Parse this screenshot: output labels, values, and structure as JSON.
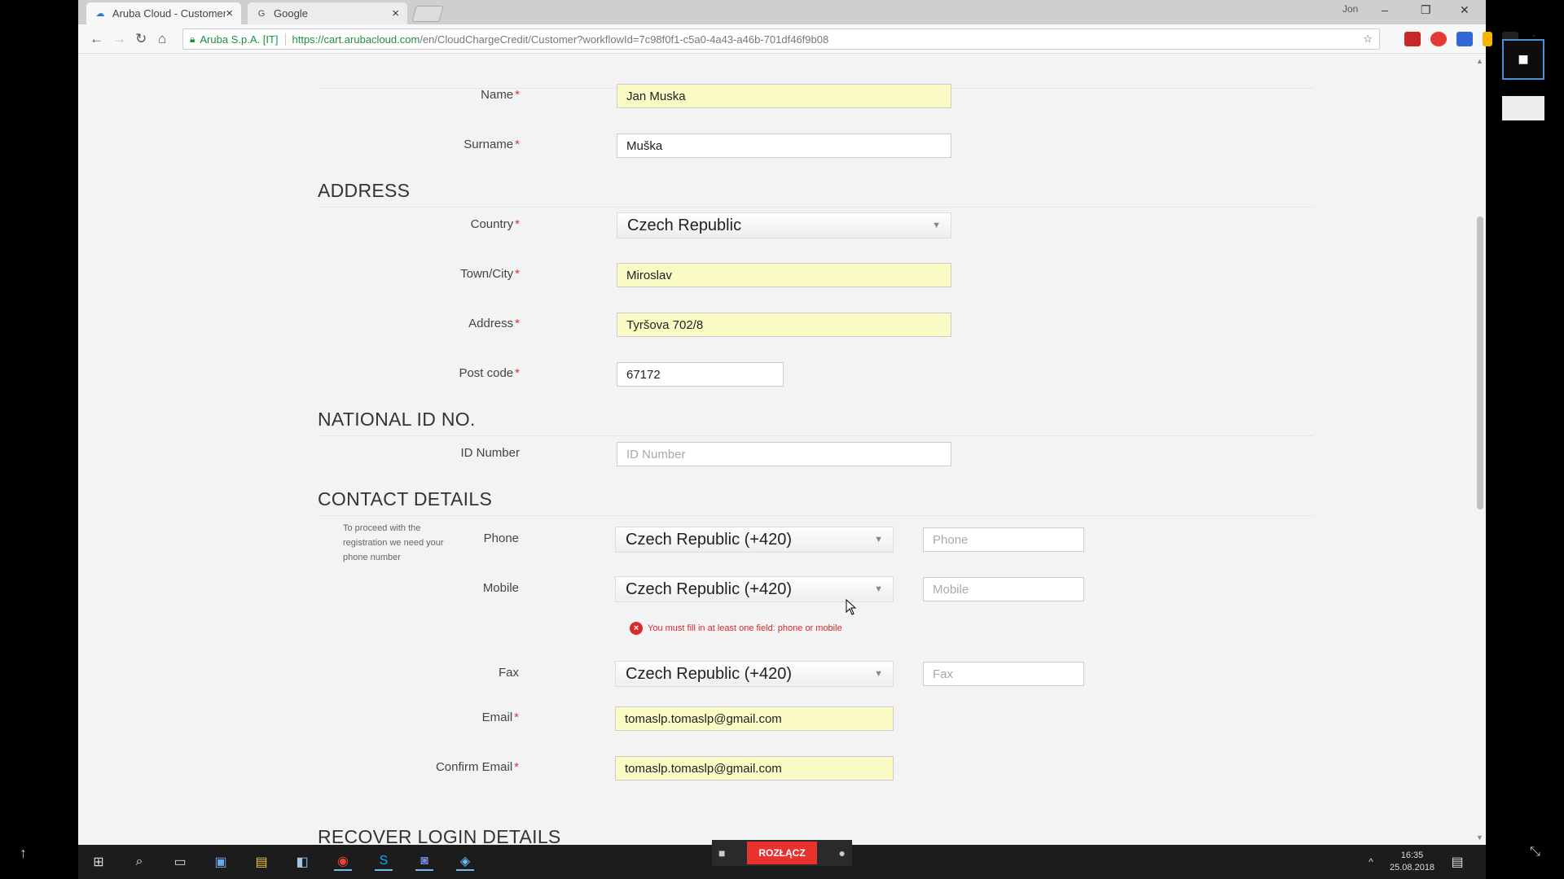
{
  "browser": {
    "tabs": [
      {
        "title": "Aruba Cloud - Customer",
        "active": true
      },
      {
        "title": "Google",
        "active": false
      }
    ],
    "window_controls": {
      "user": "Jon",
      "minimize": "–",
      "restore": "❐",
      "close": "✕"
    },
    "security_label": "Aruba S.p.A. [IT]",
    "url_host": "https://cart.arubacloud.com",
    "url_path": "/en/CloudChargeCredit/Customer?workflowId=7c98f0f1-c5a0-4a43-a46b-701df46f9b08"
  },
  "form": {
    "name": {
      "label": "Name",
      "required": "*",
      "value": "Jan Muska"
    },
    "surname": {
      "label": "Surname",
      "required": "*",
      "value": "Muška"
    },
    "address_section": "ADDRESS",
    "country": {
      "label": "Country",
      "required": "*",
      "value": "Czech Republic"
    },
    "town": {
      "label": "Town/City",
      "required": "*",
      "value": "Miroslav"
    },
    "address": {
      "label": "Address",
      "required": "*",
      "value": "Tyršova 702/8"
    },
    "postcode": {
      "label": "Post code",
      "required": "*",
      "value": "67172"
    },
    "national_section": "NATIONAL ID NO.",
    "id_number": {
      "label": "ID Number",
      "placeholder": "ID Number"
    },
    "contact_section": "CONTACT DETAILS",
    "contact_note": "To proceed with the registration we need your phone number",
    "phone": {
      "label": "Phone",
      "country": "Czech Republic (+420)",
      "placeholder": "Phone"
    },
    "mobile": {
      "label": "Mobile",
      "country": "Czech Republic (+420)",
      "placeholder": "Mobile"
    },
    "error": "You must fill in at least one field: phone or mobile",
    "fax": {
      "label": "Fax",
      "country": "Czech Republic (+420)",
      "placeholder": "Fax"
    },
    "email": {
      "label": "Email",
      "required": "*",
      "value": "tomaslp.tomaslp@gmail.com"
    },
    "confirm_email": {
      "label": "Confirm Email",
      "required": "*",
      "value": "tomaslp.tomaslp@gmail.com"
    },
    "recover_section": "RECOVER LOGIN DETAILS"
  },
  "taskbar": {
    "call_button": "ROZŁĄCZ",
    "time": "16:35",
    "date": "25.08.2018"
  },
  "colors": {
    "filled_field": "#fbfbc6",
    "error": "#d9292b",
    "secure": "#1e8e3e"
  }
}
